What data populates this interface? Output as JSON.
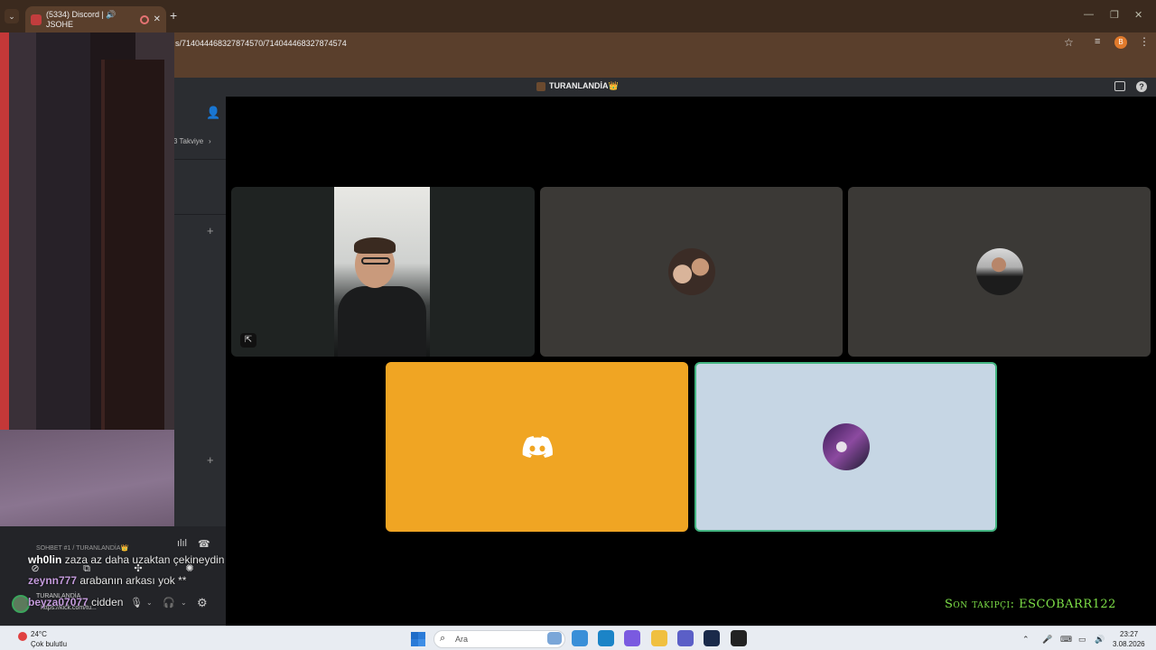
{
  "browser": {
    "tab_title": "(5334) Discord | 🔊 JSOHE",
    "tab_close": "✕",
    "new_tab": "+",
    "url": "s/714044468327874570/714044468327874574",
    "profile_initial": "B"
  },
  "discord": {
    "server_title": "TURANLANDİA👑",
    "boost_label": "3 Takviye",
    "voice_channel": "SOHBET #1 / TURANLANDİA👑",
    "user_name": "TURANLANDİA",
    "user_status": "https://kick.com/tu..."
  },
  "chat": [
    {
      "user": "wh0lin",
      "text": "zaza az daha uzaktan çekineydin"
    },
    {
      "user": "zeynn777",
      "text": "arabanın arkası yok **"
    },
    {
      "user": "beyza07077",
      "text": "cidden"
    }
  ],
  "overlay": {
    "follower_label": "Son takipçi: ESCOBARR122"
  },
  "taskbar": {
    "weather_temp": "24°C",
    "weather_desc": "Çok bulutlu",
    "search_placeholder": "Ara",
    "time": "23:27",
    "date": "3.08.2026"
  },
  "colors": {
    "accent_orange": "#f0a523",
    "speaking_green": "#43b581",
    "overlay_green": "#7ee048"
  }
}
